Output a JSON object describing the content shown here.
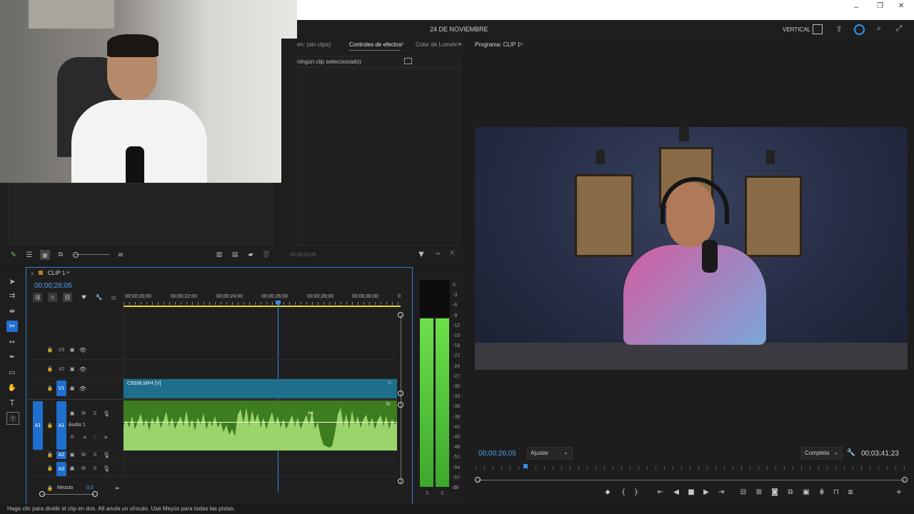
{
  "titlebar": {
    "minimize": "–",
    "restore": "❐",
    "close": "✕"
  },
  "header": {
    "project_title": "24 DE NOVIEMBRE",
    "workspace_label": "VERTICAL"
  },
  "effects_panel": {
    "tab_source": "en: (sin clips)",
    "tab_effect_controls": "Controles de efectos",
    "tab_lumetri": "Color de Lumetri",
    "no_clip": "ningún clip seleccionado)",
    "timecode": "00;00;26;05"
  },
  "program_monitor": {
    "title": "Programa: CLIP 1",
    "current_time": "00;00;26;05",
    "fit_option": "Ajustar",
    "resolution_option": "Completa",
    "duration": "00;03;41;23"
  },
  "timeline": {
    "sequence_name": "CLIP 1",
    "timecode": "00;00;26;05",
    "ruler_labels": [
      "00;00;20;00",
      "00;00;22;00",
      "00;00;24;00",
      "00;00;26;00",
      "00;00;28;00",
      "00;00;30;00",
      "0"
    ],
    "tracks": {
      "v3": "V3",
      "v2": "V2",
      "v1": "V1",
      "a1": "A1",
      "a1_name": "Audio 1",
      "a2": "A2",
      "a3": "A3",
      "mix": "Mezcla",
      "mix_value": "0,0",
      "source_a1": "A1"
    },
    "video_clip_name": "C9938.MP4 [V]",
    "track_letters": {
      "m": "M",
      "s": "S"
    }
  },
  "audio_meter": {
    "scale": [
      "0",
      "-3",
      "-6",
      "-9",
      "-12",
      "-15",
      "-18",
      "-21",
      "-24",
      "-27",
      "-30",
      "-33",
      "-36",
      "-39",
      "-42",
      "-45",
      "-48",
      "-51",
      "-54",
      "-57",
      "dB"
    ],
    "solo_labels": [
      "S",
      "S"
    ]
  },
  "status_bar": {
    "message": "Haga clic para dividir el clip en dos. Alt anula un vínculo. Use Mayús para todas las pistas."
  },
  "colors": {
    "accent_blue": "#3a8ee6",
    "video_clip": "#1f6f8b",
    "audio_clip": "#3e7d1f",
    "waveform": "#9ad46a"
  }
}
